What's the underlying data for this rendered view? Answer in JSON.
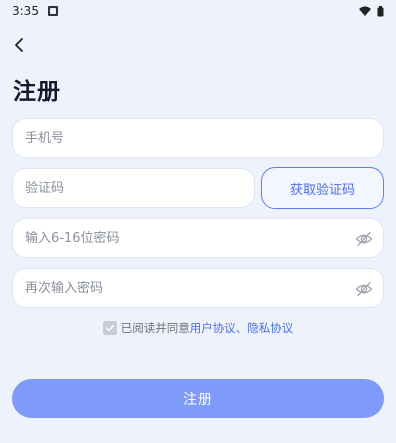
{
  "status_bar": {
    "time": "3:35"
  },
  "header": {
    "title": "注册"
  },
  "form": {
    "phone_placeholder": "手机号",
    "code_placeholder": "验证码",
    "get_code_label": "获取验证码",
    "password_placeholder": "输入6-16位密码",
    "confirm_password_placeholder": "再次输入密码"
  },
  "agreement": {
    "prefix": "已阅读并同意",
    "user_agreement": "用户协议",
    "separator": "、",
    "privacy_agreement": "隐私协议",
    "checked": true
  },
  "submit": {
    "label": "注册"
  },
  "colors": {
    "background": "#eef2fd",
    "accent": "#4c6ff0",
    "button": "#7e9bfa"
  },
  "icons": {
    "back": "chevron-left-icon",
    "notification": "notification-icon",
    "wifi": "wifi-icon",
    "battery": "battery-icon",
    "eye": "eye-off-icon",
    "check": "check-icon"
  }
}
